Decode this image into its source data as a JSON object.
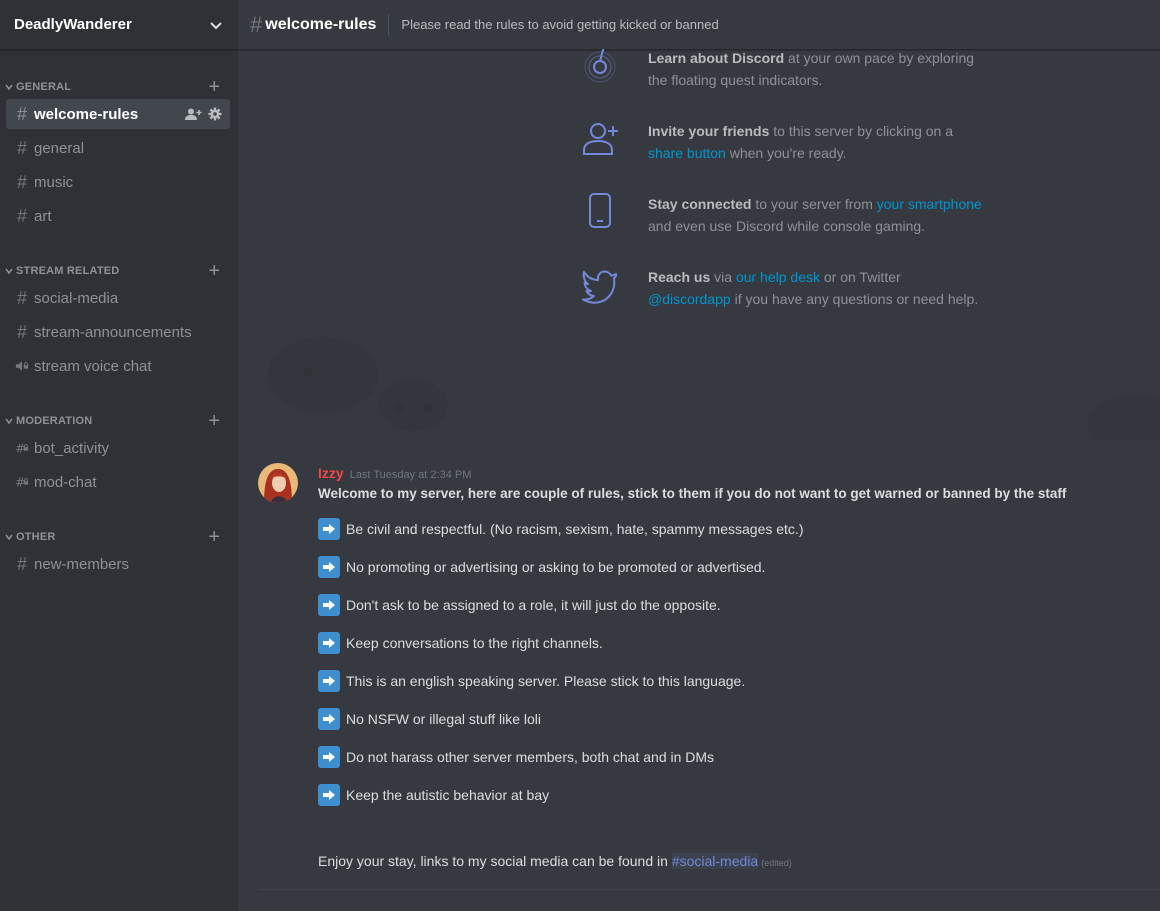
{
  "server": {
    "name": "DeadlyWanderer"
  },
  "sidebar": {
    "categories": [
      {
        "label": "GENERAL",
        "channels": [
          {
            "name": "welcome-rules",
            "type": "text",
            "active": true
          },
          {
            "name": "general",
            "type": "text"
          },
          {
            "name": "music",
            "type": "text"
          },
          {
            "name": "art",
            "type": "text"
          }
        ]
      },
      {
        "label": "STREAM RELATED",
        "channels": [
          {
            "name": "social-media",
            "type": "text"
          },
          {
            "name": "stream-announcements",
            "type": "text"
          },
          {
            "name": "stream voice chat",
            "type": "voice-locked"
          }
        ]
      },
      {
        "label": "MODERATION",
        "channels": [
          {
            "name": "bot_activity",
            "type": "text-locked"
          },
          {
            "name": "mod-chat",
            "type": "text-locked"
          }
        ]
      },
      {
        "label": "OTHER",
        "channels": [
          {
            "name": "new-members",
            "type": "text"
          }
        ]
      }
    ]
  },
  "topbar": {
    "hash": "#",
    "channel": "welcome-rules",
    "topic": "Please read the rules to avoid getting kicked or banned"
  },
  "welcome": {
    "items": [
      {
        "icon": "compass-icon",
        "bold": "Learn about Discord",
        "text1": " at your own pace by exploring",
        "text2": "the floating quest indicators."
      },
      {
        "icon": "add-user-icon",
        "bold": "Invite your friends",
        "text1": " to this server by clicking on a",
        "link": "share button",
        "text2": " when you're ready."
      },
      {
        "icon": "smartphone-icon",
        "bold": "Stay connected",
        "text1": " to your server from ",
        "link": "your smartphone",
        "text2": "and even use Discord while console gaming."
      },
      {
        "icon": "twitter-icon",
        "bold": "Reach us",
        "text1": " via ",
        "link": "our help desk",
        "text1b": " or on Twitter",
        "link2": "@discordapp",
        "text2": " if you have any questions or need help."
      }
    ]
  },
  "message": {
    "author": "Izzy",
    "author_color": "#f04747",
    "timestamp": "Last Tuesday at 2:34 PM",
    "intro": "Welcome to my server, here are couple of rules, stick to them if you do not want to get warned or banned by the staff",
    "rules": [
      "Be civil and respectful. (No racism, sexism, hate, spammy messages etc.)",
      "No promoting or advertising or asking to be promoted or advertised.",
      "Don't ask to be assigned to a role, it will just do the opposite.",
      "Keep conversations to the right channels.",
      "This is an english speaking server. Please stick to this language.",
      "No NSFW or illegal stuff like loli",
      "Do not harass other server members, both chat and in DMs",
      "Keep the autistic behavior at bay"
    ],
    "outro_text": "Enjoy your stay, links to my social media can be found in ",
    "outro_mention": "#social-media",
    "edited": "(edited)"
  },
  "colors": {
    "sidebar_bg": "#2f3136",
    "main_bg": "#36393f",
    "link": "#0096cf",
    "mention": "#7289da",
    "emoji_bg": "#3e8ed0"
  }
}
